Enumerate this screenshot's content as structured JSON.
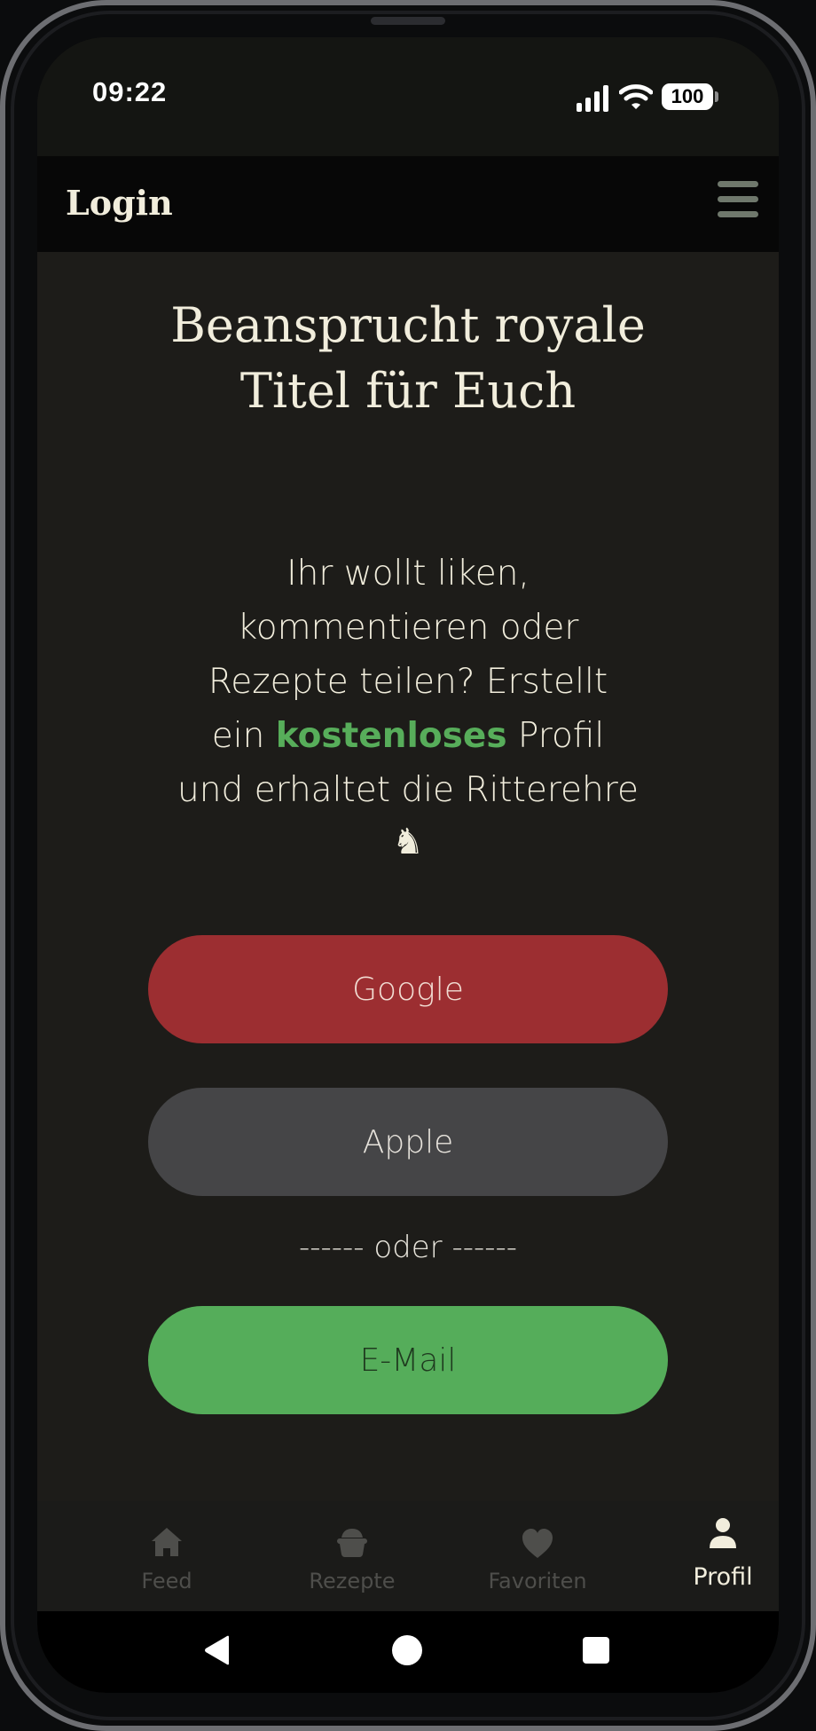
{
  "status_bar": {
    "time": "09:22",
    "battery": "100",
    "icons": [
      "signal-icon",
      "wifi-icon",
      "battery-icon"
    ]
  },
  "app_bar": {
    "title": "Login",
    "menu_icon": "hamburger-menu-icon"
  },
  "main": {
    "headline_line1": "Beansprucht royale",
    "headline_line2": "Titel für Euch",
    "intro_lines": [
      "Ihr wollt liken,",
      "kommentieren oder",
      "Rezepte teilen? Erstellt"
    ],
    "intro_ein": "ein ",
    "intro_highlight": "kostenloses",
    "intro_after_highlight": " Profil",
    "intro_last_line": "und erhaltet die Ritterehre",
    "intro_emoji": "♞",
    "buttons": {
      "google": "Google",
      "apple": "Apple",
      "email": "E-Mail"
    },
    "divider": "------ oder ------"
  },
  "bottom_nav": {
    "items": [
      {
        "label": "Feed",
        "icon": "house-icon",
        "active": false
      },
      {
        "label": "Rezepte",
        "icon": "pot-icon",
        "active": false
      },
      {
        "label": "Favoriten",
        "icon": "heart-icon",
        "active": false
      },
      {
        "label": "Profil",
        "icon": "person-icon",
        "active": true
      }
    ]
  },
  "system_nav": {
    "icons": [
      "back-icon",
      "home-icon",
      "recents-icon"
    ]
  },
  "colors": {
    "background": "#1d1c19",
    "app_bar": "#070707",
    "text": "#f1eddc",
    "accent_green": "#55ad5a",
    "google_red": "#9c2e31",
    "apple_gray": "#454547"
  }
}
